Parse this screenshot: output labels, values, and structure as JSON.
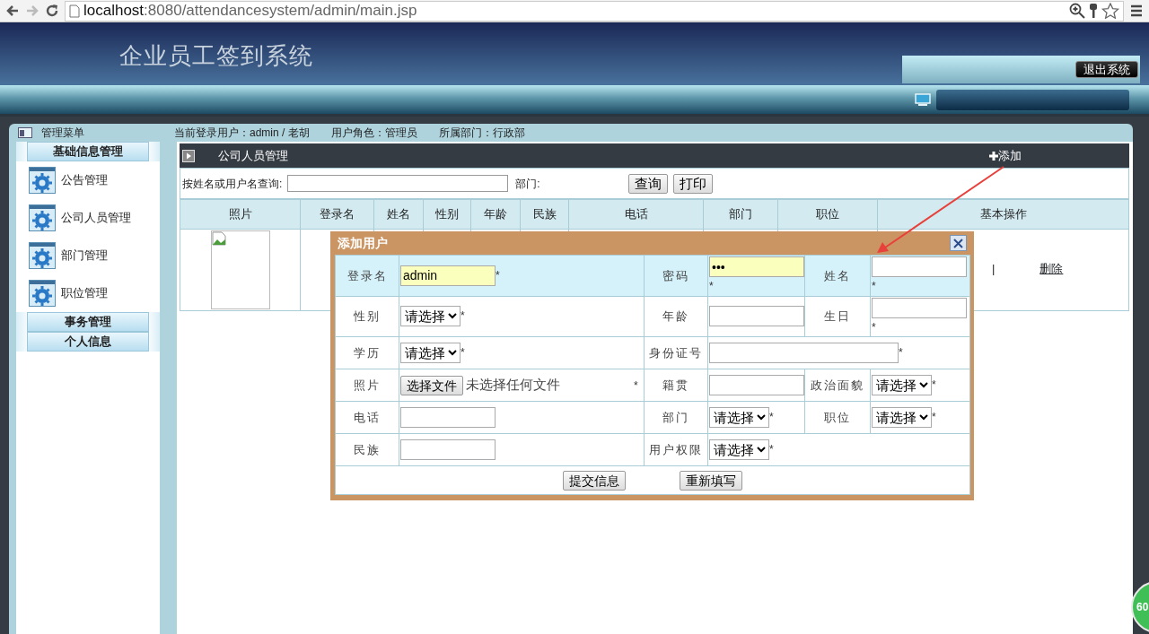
{
  "browser": {
    "url_host": "localhost",
    "url_path": ":8080/attendancesystem/admin/main.jsp"
  },
  "header": {
    "title": "企业员工签到系统",
    "logout_button": "退出系统"
  },
  "info_bar": {
    "menu_title": "管理菜单",
    "user_info": "当前登录用户：admin / 老胡　　用户角色：管理员　　所属部门：行政部"
  },
  "sidebar": {
    "sections": [
      {
        "title": "基础信息管理",
        "items": [
          {
            "label": "公告管理"
          },
          {
            "label": "公司人员管理"
          },
          {
            "label": "部门管理"
          },
          {
            "label": "职位管理"
          }
        ]
      },
      {
        "title": "事务管理"
      },
      {
        "title": "个人信息"
      }
    ]
  },
  "main": {
    "title": "公司人员管理",
    "add_link": "添加",
    "search": {
      "label": "按姓名或用户名查询:",
      "dept_label": "部门:",
      "buttons": [
        "查询",
        "打印"
      ]
    },
    "table": {
      "columns": [
        "照片",
        "登录名",
        "姓名",
        "性别",
        "年龄",
        "民族",
        "电话",
        "部门",
        "职位",
        "基本操作"
      ],
      "rows": [
        {
          "operations": [
            {
              "kind": "separator",
              "text": "|"
            },
            {
              "kind": "link",
              "text": "删除"
            }
          ]
        }
      ]
    }
  },
  "modal": {
    "title": "添加用户",
    "rows": [
      {
        "highlighted": true,
        "fields": [
          {
            "label": "登录名",
            "kind": "text",
            "value": "admin",
            "autofilled": true,
            "required_mark": "*"
          },
          {
            "label": "密码",
            "kind": "text",
            "value": "•••",
            "autofilled": true,
            "required_mark": "*"
          },
          {
            "label": "姓名",
            "kind": "text",
            "autofilled": false,
            "required_mark": "*"
          }
        ]
      },
      {
        "highlighted": false,
        "fields": [
          {
            "label": "性别",
            "kind": "select",
            "value": "请选择",
            "required_mark": "*"
          },
          {
            "label": "年龄",
            "kind": "text",
            "autofilled": false
          },
          {
            "label": "生日",
            "kind": "text",
            "autofilled": false,
            "required_mark": "*"
          }
        ]
      },
      {
        "highlighted": false,
        "fields": [
          {
            "label": "学历",
            "kind": "select",
            "value": "请选择",
            "required_mark": "*"
          },
          {
            "label": "身份证号",
            "kind": "wide-text",
            "autofilled": false,
            "required_mark": "*"
          }
        ]
      },
      {
        "highlighted": false,
        "fields": [
          {
            "label": "照片",
            "kind": "file",
            "button": "选择文件",
            "status": "未选择任何文件",
            "required_mark": "*"
          },
          {
            "label": "籍贯",
            "kind": "text",
            "autofilled": false
          },
          {
            "label": "政治面貌",
            "kind": "select",
            "value": "请选择",
            "required_mark": "*"
          }
        ]
      },
      {
        "highlighted": false,
        "fields": [
          {
            "label": "电话",
            "kind": "text",
            "autofilled": false
          },
          {
            "label": "部门",
            "kind": "select",
            "value": "请选择",
            "required_mark": "*"
          },
          {
            "label": "职位",
            "kind": "select",
            "value": "请选择",
            "required_mark": "*"
          }
        ]
      },
      {
        "highlighted": false,
        "fields": [
          {
            "label": "民族",
            "kind": "text",
            "autofilled": false
          },
          {
            "label": "用户权限",
            "kind": "wide-select",
            "value": "请选择",
            "required_mark": "*"
          }
        ]
      }
    ],
    "buttons": [
      "提交信息",
      "重新填写"
    ]
  },
  "badge": {
    "text": "60"
  }
}
